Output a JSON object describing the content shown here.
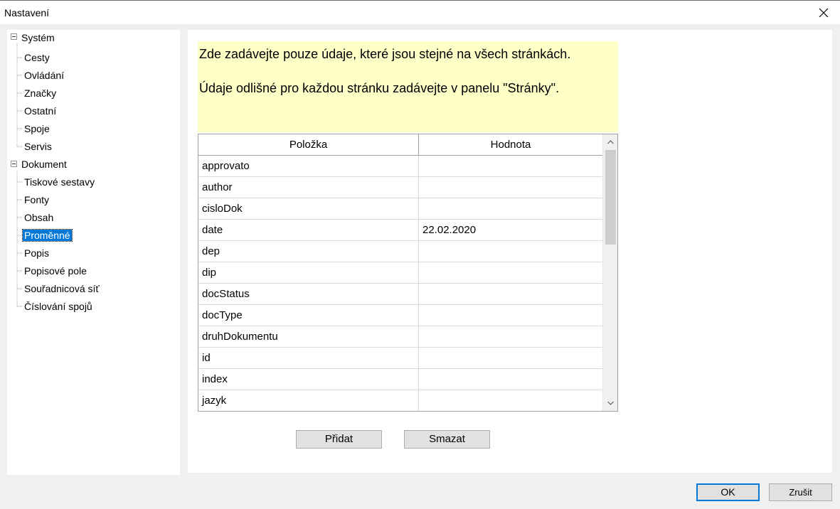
{
  "window": {
    "title": "Nastavení"
  },
  "tree": {
    "roots": [
      {
        "label": "Systém",
        "children": [
          "Cesty",
          "Ovládání",
          "Značky",
          "Ostatní",
          "Spoje",
          "Servis"
        ]
      },
      {
        "label": "Dokument",
        "children": [
          "Tiskové sestavy",
          "Fonty",
          "Obsah",
          "Proměnné",
          "Popis",
          "Popisové pole",
          "Souřadnicová síť",
          "Číslování spojů"
        ]
      }
    ],
    "selected": "Proměnné"
  },
  "notice": {
    "line1": "Zde zadávejte pouze údaje, které jsou stejné na všech stránkách.",
    "line2": "Údaje odlišné pro každou stránku zadávejte v panelu \"Stránky\"."
  },
  "grid": {
    "headers": {
      "item": "Položka",
      "value": "Hodnota"
    },
    "rows": [
      {
        "item": "approvato",
        "value": ""
      },
      {
        "item": "author",
        "value": ""
      },
      {
        "item": "cisloDok",
        "value": ""
      },
      {
        "item": "date",
        "value": "22.02.2020"
      },
      {
        "item": "dep",
        "value": ""
      },
      {
        "item": "dip",
        "value": ""
      },
      {
        "item": "docStatus",
        "value": ""
      },
      {
        "item": "docType",
        "value": ""
      },
      {
        "item": "druhDokumentu",
        "value": ""
      },
      {
        "item": "id",
        "value": ""
      },
      {
        "item": "index",
        "value": ""
      },
      {
        "item": "jazyk",
        "value": ""
      }
    ]
  },
  "buttons": {
    "add": "Přidat",
    "delete": "Smazat",
    "ok": "OK",
    "cancel": "Zrušit"
  },
  "colors": {
    "selection": "#0078d7",
    "notice_bg": "#ffffc8"
  }
}
